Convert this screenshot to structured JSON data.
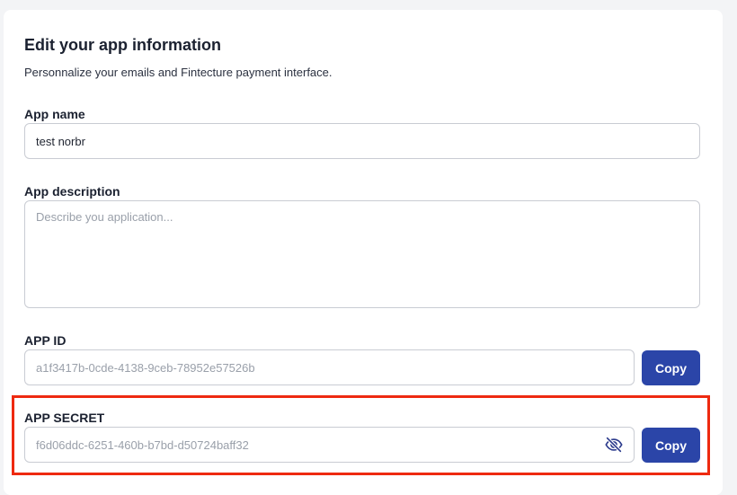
{
  "form": {
    "title": "Edit your app information",
    "subtitle": "Personnalize your emails and Fintecture payment interface.",
    "app_name": {
      "label": "App name",
      "value": "test norbr"
    },
    "app_description": {
      "label": "App description",
      "placeholder": "Describe you application..."
    },
    "app_id": {
      "label": "APP ID",
      "value": "a1f3417b-0cde-4138-9ceb-78952e57526b",
      "copy_label": "Copy"
    },
    "app_secret": {
      "label": "APP SECRET",
      "value": "f6d06ddc-6251-460b-b7bd-d50724baff32",
      "copy_label": "Copy",
      "toggle_icon": "eye-slash-icon"
    }
  },
  "colors": {
    "primary_button": "#2b45a8",
    "highlight_border": "#ee2a10"
  }
}
